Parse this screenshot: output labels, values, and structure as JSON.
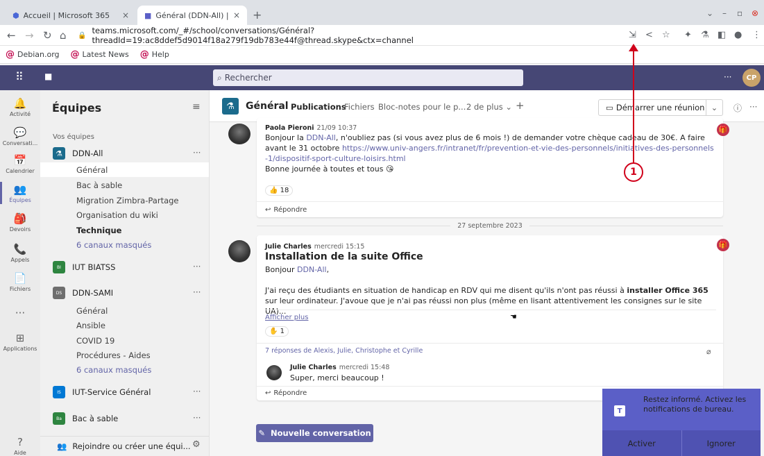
{
  "browser": {
    "tabs": [
      {
        "title": "Accueil | Microsoft 365",
        "close": "×"
      },
      {
        "title": "Général (DDN-All) | Microsoft",
        "close": "×"
      }
    ],
    "new_tab": "+",
    "url": "teams.microsoft.com/_#/school/conversations/Général?threadId=19:ac8ddef5d9014f18a279f19db783e44f@thread.skype&ctx=channel",
    "bookmarks": [
      "Debian.org",
      "Latest News",
      "Help"
    ]
  },
  "teams": {
    "search_placeholder": "Rechercher",
    "avatar_initials": "CP",
    "rail": [
      {
        "label": "Activité",
        "icon": "bell-icon",
        "glyph": "🔔"
      },
      {
        "label": "Conversati...",
        "icon": "chat-icon",
        "glyph": "💬"
      },
      {
        "label": "Calendrier",
        "icon": "calendar-icon",
        "glyph": "📅"
      },
      {
        "label": "Équipes",
        "icon": "teams-icon",
        "glyph": "👥"
      },
      {
        "label": "Devoirs",
        "icon": "assignments-icon",
        "glyph": "🎒"
      },
      {
        "label": "Appels",
        "icon": "phone-icon",
        "glyph": "📞"
      },
      {
        "label": "Fichiers",
        "icon": "file-icon",
        "glyph": "📄"
      },
      {
        "label": "",
        "icon": "more-icon",
        "glyph": "···"
      },
      {
        "label": "Applications",
        "icon": "apps-icon",
        "glyph": "⊞"
      },
      {
        "label": "Aide",
        "icon": "help-icon",
        "glyph": "?"
      }
    ],
    "pane_title": "Équipes",
    "your_teams": "Vos équipes",
    "teams_list": [
      {
        "name": "DDN-All",
        "badge": "",
        "color": "#1b6b8c"
      },
      {
        "name": "IUT BIATSS",
        "badge": "BI",
        "color": "#2e8540"
      },
      {
        "name": "DDN-SAMI",
        "badge": "DS",
        "color": "#6e6e6e"
      },
      {
        "name": "IUT-Service Général",
        "badge": "IS",
        "color": "#0078d4"
      },
      {
        "name": "Bac à sable",
        "badge": "Ba",
        "color": "#2e8540"
      }
    ],
    "channels_ddn_all": [
      "Général",
      "Bac à sable",
      "Migration Zimbra-Partage",
      "Organisation du wiki",
      "Technique",
      "6 canaux masqués"
    ],
    "channels_ddn_sami": [
      "Général",
      "Ansible",
      "COVID 19",
      "Procédures - Aides",
      "6 canaux masqués"
    ],
    "join_label": "Rejoindre ou créer une équi...",
    "channel": {
      "name": "Général",
      "tabs": [
        "Publications",
        "Fichiers",
        "Bloc-notes pour le p...",
        "2 de plus ⌄",
        "+"
      ],
      "meet_label": "Démarrer une réunion"
    },
    "posts": [
      {
        "author": "Paola Pieroni",
        "time": "21/09 10:37",
        "text_a": "Bonjour la ",
        "mention": "DDN-All",
        "text_b": ", n'oubliez pas (si vous avez plus de 6 mois !) de demander votre chèque cadeau de 30€. A faire avant le 31 octobre ",
        "link": "https://www.univ-angers.fr/intranet/fr/prevention-et-vie-des-personnels/initiatives-des-personnels-1/dispositif-sport-culture-loisirs.html",
        "line3": "Bonne journée à toutes et tous 😘",
        "reaction": "👍 18",
        "reply": "Répondre"
      },
      {
        "author": "Julie Charles",
        "time": "mercredi 15:15",
        "title": "Installation de la suite Office",
        "greet_a": "Bonjour ",
        "greet_mention": "DDN-All",
        "greet_b": ",",
        "p_a": "J'ai reçu des étudiants en situation de handicap en RDV qui me disent qu'ils n'ont pas réussi à ",
        "p_bold": "installer Office 365",
        "p_b": " sur leur ordinateur. J'avoue que je n'ai pas réussi non plus (même en lisant attentivement les consignes sur le site UA)...",
        "show_more": "Afficher plus",
        "reaction": "✋ 1",
        "replies_summary": "7 réponses de Alexis, Julie, Christophe et Cyrille",
        "reply_author": "Julie Charles",
        "reply_time": "mercredi 15:48",
        "reply_text": "Super, merci beaucoup !",
        "reply": "Répondre"
      }
    ],
    "date_separator": "27 septembre 2023",
    "new_conversation": "Nouvelle conversation",
    "toast": {
      "message": "Restez informé. Activez les notifications de bureau.",
      "accept": "Activer",
      "ignore": "Ignorer"
    }
  },
  "annotation": {
    "number": "1",
    "color": "#d0021b"
  }
}
